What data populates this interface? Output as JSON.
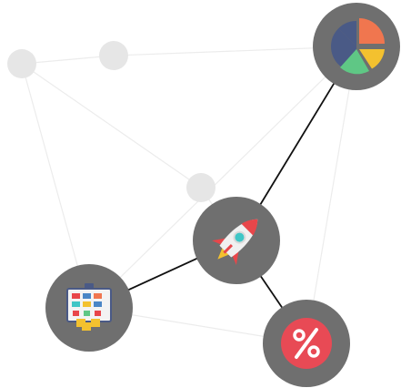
{
  "diagram": {
    "nodes": [
      {
        "id": "bg-node-1",
        "kind": "ghost"
      },
      {
        "id": "bg-node-2",
        "kind": "ghost"
      },
      {
        "id": "bg-node-3",
        "kind": "ghost"
      },
      {
        "id": "pie-chart-node",
        "kind": "icon",
        "icon": "pie-chart-icon"
      },
      {
        "id": "rocket-node",
        "kind": "icon",
        "icon": "rocket-icon"
      },
      {
        "id": "planning-board-node",
        "kind": "icon",
        "icon": "planning-board-icon"
      },
      {
        "id": "discount-node",
        "kind": "icon",
        "icon": "percent-discount-icon"
      }
    ],
    "edges": [
      {
        "from": "rocket-node",
        "to": "pie-chart-node",
        "style": "active"
      },
      {
        "from": "rocket-node",
        "to": "planning-board-node",
        "style": "active"
      },
      {
        "from": "rocket-node",
        "to": "discount-node",
        "style": "active"
      },
      {
        "from": "bg-node-1",
        "to": "bg-node-2",
        "style": "faint"
      },
      {
        "from": "bg-node-2",
        "to": "pie-chart-node",
        "style": "faint"
      },
      {
        "from": "bg-node-1",
        "to": "bg-node-3",
        "style": "faint"
      },
      {
        "from": "bg-node-1",
        "to": "planning-board-node",
        "style": "faint"
      },
      {
        "from": "bg-node-3",
        "to": "rocket-node",
        "style": "faint"
      },
      {
        "from": "pie-chart-node",
        "to": "planning-board-node",
        "style": "faint"
      },
      {
        "from": "pie-chart-node",
        "to": "discount-node",
        "style": "faint"
      },
      {
        "from": "planning-board-node",
        "to": "discount-node",
        "style": "faint"
      }
    ],
    "colors": {
      "node_fill": "#6f6f6f",
      "ghost_fill": "#e6e6e6",
      "active_edge": "#111111",
      "faint_edge": "#ececec",
      "pie_blue": "#4a5a86",
      "pie_orange": "#f0764f",
      "pie_yellow": "#f3c12f",
      "pie_green": "#5fc785",
      "rocket_body": "#f0f0f0",
      "rocket_red": "#e8464a",
      "rocket_window": "#3fc6c6",
      "discount_red": "#e84a55"
    }
  }
}
